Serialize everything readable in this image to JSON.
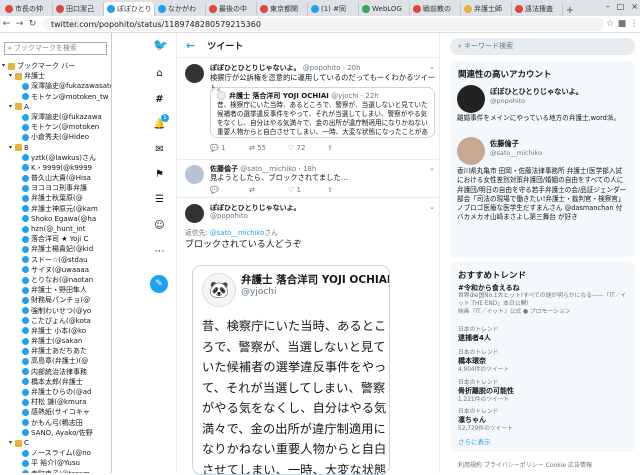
{
  "browser": {
    "tabs": [
      {
        "title": "市長の仲",
        "color": "#e0463c",
        "active": false
      },
      {
        "title": "田口潔己",
        "color": "#e0463c",
        "active": false
      },
      {
        "title": "ぽぽひとり",
        "color": "#1da1f2",
        "active": true
      },
      {
        "title": "なかがわ",
        "color": "#1da1f2",
        "active": false
      },
      {
        "title": "最後の中",
        "color": "#e0463c",
        "active": false
      },
      {
        "title": "東京都関",
        "color": "#e0463c",
        "active": false
      },
      {
        "title": "(1) #同",
        "color": "#1da1f2",
        "active": false
      },
      {
        "title": "WebLOG",
        "color": "#34a853",
        "active": false
      },
      {
        "title": "戦前教の",
        "color": "#e0463c",
        "active": false
      },
      {
        "title": "弁護士師",
        "color": "#e8b33a",
        "active": false
      },
      {
        "title": "遠法捜査",
        "color": "#e0463c",
        "active": false
      }
    ],
    "url": "twitter.com/popohito/status/1189748280579215360",
    "window_controls": [
      "–",
      "□",
      "×"
    ]
  },
  "bookmarks": {
    "search_placeholder": "ブックマークを検索",
    "items": [
      {
        "label": "ブックマーク バー",
        "type": "folder",
        "indent": 0
      },
      {
        "label": "弁護士",
        "type": "folder",
        "indent": 1
      },
      {
        "label": "深澤諭史@fukazawasatoshi",
        "type": "tw",
        "indent": 2
      },
      {
        "label": "モトケン@motoken_tw",
        "type": "tw",
        "indent": 2
      },
      {
        "label": "A",
        "type": "folder",
        "indent": 1
      },
      {
        "label": "深澤諭史(@fukazawa",
        "type": "tw",
        "indent": 2
      },
      {
        "label": "モトケン(@motoken",
        "type": "tw",
        "indent": 2
      },
      {
        "label": "小倉秀夫(@Hideo",
        "type": "tw",
        "indent": 2
      },
      {
        "label": "B",
        "type": "folder",
        "indent": 1
      },
      {
        "label": "yztk(@lawkus)さん",
        "type": "tw",
        "indent": 2
      },
      {
        "label": "K・9999(@k9999",
        "type": "tw",
        "indent": 2
      },
      {
        "label": "普久山大貴(@Hisa",
        "type": "tw",
        "indent": 2
      },
      {
        "label": "ヨコヨコ刑事弁護",
        "type": "tw",
        "indent": 2
      },
      {
        "label": "弁護士秋葉原(@",
        "type": "tw",
        "indent": 2
      },
      {
        "label": "弁護士神原元(@kam",
        "type": "tw",
        "indent": 2
      },
      {
        "label": "Shoko Egawa(@ha",
        "type": "tw",
        "indent": 2
      },
      {
        "label": "hzn(@_hunt_int",
        "type": "tw",
        "indent": 2
      },
      {
        "label": "落合洋司 ★ Yoji C",
        "type": "tw",
        "indent": 2
      },
      {
        "label": "弁護士楊貴妃(@kid",
        "type": "tw",
        "indent": 2
      },
      {
        "label": "スドー☆(@stdau",
        "type": "tw",
        "indent": 2
      },
      {
        "label": "サイヌ(@uwaaaa",
        "type": "tw",
        "indent": 2
      },
      {
        "label": "とりなお(@naotan",
        "type": "tw",
        "indent": 2
      },
      {
        "label": "弁護士・野田隼人",
        "type": "tw",
        "indent": 2
      },
      {
        "label": "財務局パンチョ(@",
        "type": "tw",
        "indent": 2
      },
      {
        "label": "強制わいせつ(@yo",
        "type": "tw",
        "indent": 2
      },
      {
        "label": "こたぴょん(@kota",
        "type": "tw",
        "indent": 2
      },
      {
        "label": "弁護士 小本(@ko",
        "type": "tw",
        "indent": 2
      },
      {
        "label": "弁護士(@sakan",
        "type": "tw",
        "indent": 2
      },
      {
        "label": "弁護士あだちあた",
        "type": "tw",
        "indent": 2
      },
      {
        "label": "高島章(弁護士)(@",
        "type": "tw",
        "indent": 2
      },
      {
        "label": "内部統治法律事務",
        "type": "tw",
        "indent": 2
      },
      {
        "label": "橋本太郎(弁護士",
        "type": "tw",
        "indent": 2
      },
      {
        "label": "弁護士ひらの(@ad",
        "type": "tw",
        "indent": 2
      },
      {
        "label": "村松 謙(@kmura",
        "type": "tw",
        "indent": 2
      },
      {
        "label": "感熱紙(サイコキャ",
        "type": "tw",
        "indent": 2
      },
      {
        "label": "かもん弓(鴨志田",
        "type": "tw",
        "indent": 2
      },
      {
        "label": "SANO, Ayako/佐野",
        "type": "tw",
        "indent": 2
      },
      {
        "label": "C",
        "type": "folder",
        "indent": 1
      },
      {
        "label": "ノースライム(@no",
        "type": "tw",
        "indent": 2
      },
      {
        "label": "平 裕介(@Yusu",
        "type": "tw",
        "indent": 2
      },
      {
        "label": "寺町東子(@teram",
        "type": "tw",
        "indent": 2
      },
      {
        "label": "スヤスヤいちご(@",
        "type": "tw",
        "indent": 2
      }
    ]
  },
  "left_nav": {
    "icons": [
      "twitter-bird-icon",
      "home-icon",
      "explore-hash-icon",
      "notifications-bell-icon",
      "messages-mail-icon",
      "bookmarks-icon",
      "lists-icon",
      "profile-icon",
      "more-icon",
      "compose-tweet-icon"
    ],
    "notification_badge": "1"
  },
  "timeline": {
    "header_title": "ツイート",
    "tweet1": {
      "name": "ぽぽひとひとりじゃないよ。",
      "handle": "@popohito · 20h",
      "text": "検察庁が公訴権を恣意的に運用しているのだってもーくわかるツイート。",
      "quote_name": "弁護士 落合洋司 YOJI OCHIAI",
      "quote_handle": "@yjochi · 22h",
      "quote_text": "昔、検察庁にいた当時、あるところで、警察が、当選しないと見ていた候補者の選挙違反事件をやって、それが当選してしまい、警察がやる気をなくし、自分はやる気満々で、金の出所が違庁制適用になりかねない重要人物からと自白させてしまい、一時、大変な状態になったことがあった。笑",
      "replies": "1",
      "retweets": "55",
      "likes": "72"
    },
    "tweet2": {
      "name": "佐藤倫子",
      "handle": "@sato__michiko · 18h",
      "text": "見ようとしたら、ブロックされてました…",
      "replies": "",
      "retweets": "",
      "likes": "1"
    },
    "tweet3": {
      "name": "ぽぽひとひとりじゃないよ。",
      "handle": "@popohito",
      "reply_to_label": "返信先:",
      "reply_to_handle": "@sato__michiko",
      "reply_to_suffix": "さん",
      "text": "ブロックされている人どうぞ",
      "card_name": "弁護士 落合洋司 YOJI OCHIAI",
      "card_handle": "@yjochi",
      "card_text": "昔、検察庁にいた当時、あるところで、警察が、当選しないと見ていた候補者の選挙違反事件をやって、それが当選してしまい、警察がやる気をなくし、自分はやる気満々で、金の出所が違庁制適用になりかねない重要人物からと自白させてしまい、一時、大変な状態"
    }
  },
  "right": {
    "search_placeholder": "キーワード検索",
    "related_title": "関連性の高いアカウント",
    "accounts": [
      {
        "name": "ぽぽひとひとりじゃないよ。",
        "handle": "@popohito",
        "bio": "離婚事件をメインにやっている地方の弁護士,word派。",
        "dark": true
      },
      {
        "name": "佐藤倫子",
        "handle": "@sato__michiko",
        "bio": "香川県丸亀市 田岡・佐藤法律事務所 弁護士(医学部入試における女性差別対策弁護団/婚姻の自由をすべての人に弁護団/明日の自由を守る若手弁護士の会/品証ジェンダー部会「司法の現場で働きたい!弁護士・裁判官・検察官」ノブロゴ医療な医学生だすまんさん @dasmanchan 付バカメカオ山崎まさよし第三舞台 が好き",
        "dark": false
      }
    ],
    "trends_title": "おすすめトレンド",
    "trends": [
      {
        "context": "",
        "name": "#令和から食えるね",
        "count": "世界die国No.1大ヒット!すべての謎が明らかになる——「IT／イット THE END」本日公開!",
        "extra": "映画『IT／イット』公式 ● プロモーション"
      },
      {
        "context": "日本のトレンド",
        "name": "逮捕者4人",
        "count": ""
      },
      {
        "context": "日本のトレンド",
        "name": "橋本環奈",
        "count": "4,904件のツイート"
      },
      {
        "context": "日本のトレンド",
        "name": "骨折離脱の可能性",
        "count": "1,221件のツイート"
      },
      {
        "context": "日本のトレンド",
        "name": "凛ちゃん",
        "count": "52,729件のツイート"
      }
    ],
    "more_label": "さらに表示",
    "footer": "利用規約  プライバシーポリシー  Cookie  広告情報"
  }
}
